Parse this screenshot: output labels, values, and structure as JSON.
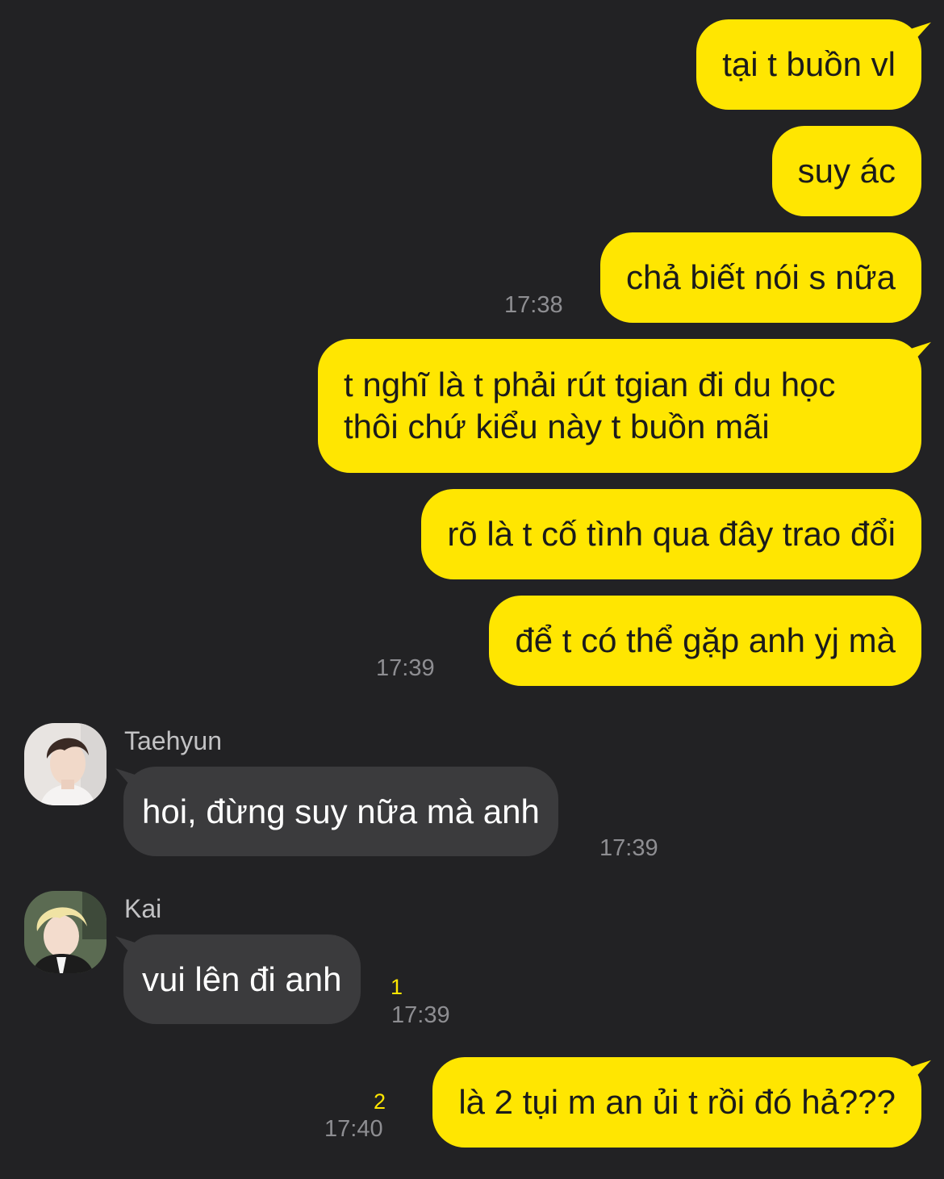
{
  "messages_out": [
    {
      "text": "tại t buồn vl"
    },
    {
      "text": "suy ác"
    },
    {
      "text": "chả biết nói s nữa",
      "time": "17:38"
    },
    {
      "line1": "t nghĩ là t phải rút tgian đi du học",
      "line2": "thôi chứ kiểu này t buồn mãi"
    },
    {
      "text": "rõ là t cố tình qua đây trao đổi"
    },
    {
      "text": "để t có thể gặp anh yj mà",
      "time": "17:39"
    }
  ],
  "messages_in": [
    {
      "sender": "Taehyun",
      "text": "hoi, đừng suy nữa mà anh",
      "time": "17:39"
    },
    {
      "sender": "Kai",
      "text": "vui lên đi anh",
      "time": "17:39",
      "unread": "1"
    }
  ],
  "last_out": {
    "text": "là 2 tụi m an ủi t rồi đó hả???",
    "time": "17:40",
    "unread": "2"
  },
  "colors": {
    "background": "#222224",
    "outgoing_bubble": "#FFE601",
    "incoming_bubble": "#3b3b3d",
    "timestamp": "#8e8e92"
  }
}
